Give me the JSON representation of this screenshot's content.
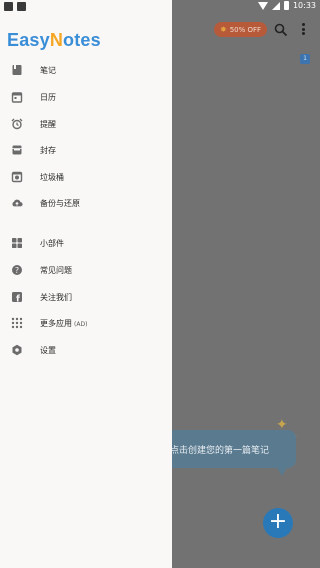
{
  "status_bar": {
    "time": "10:33"
  },
  "app": {
    "title_logo": {
      "part1": "Easy",
      "part2": "N",
      "part3": "otes"
    },
    "promo": {
      "label": "50% OFF"
    },
    "empty_tip": "点击创建您的第一篇笔记",
    "fab_label": "+",
    "calendar_badge": "1"
  },
  "drawer": {
    "items": [
      {
        "label": "笔记",
        "icon": "note-icon"
      },
      {
        "label": "日历",
        "icon": "calendar-icon"
      },
      {
        "label": "提醒",
        "icon": "alarm-icon"
      },
      {
        "label": "封存",
        "icon": "archive-icon"
      },
      {
        "label": "垃圾桶",
        "icon": "trash-icon"
      },
      {
        "label": "备份与还原",
        "icon": "cloud-icon"
      }
    ],
    "extra_items": [
      {
        "label": "小部件",
        "icon": "widget-icon"
      },
      {
        "label": "常见问题",
        "icon": "help-icon"
      },
      {
        "label": "关注我们",
        "icon": "facebook-icon"
      },
      {
        "label": "更多应用",
        "badge": "(AD)",
        "icon": "apps-icon"
      },
      {
        "label": "设置",
        "icon": "gear-icon"
      }
    ]
  }
}
